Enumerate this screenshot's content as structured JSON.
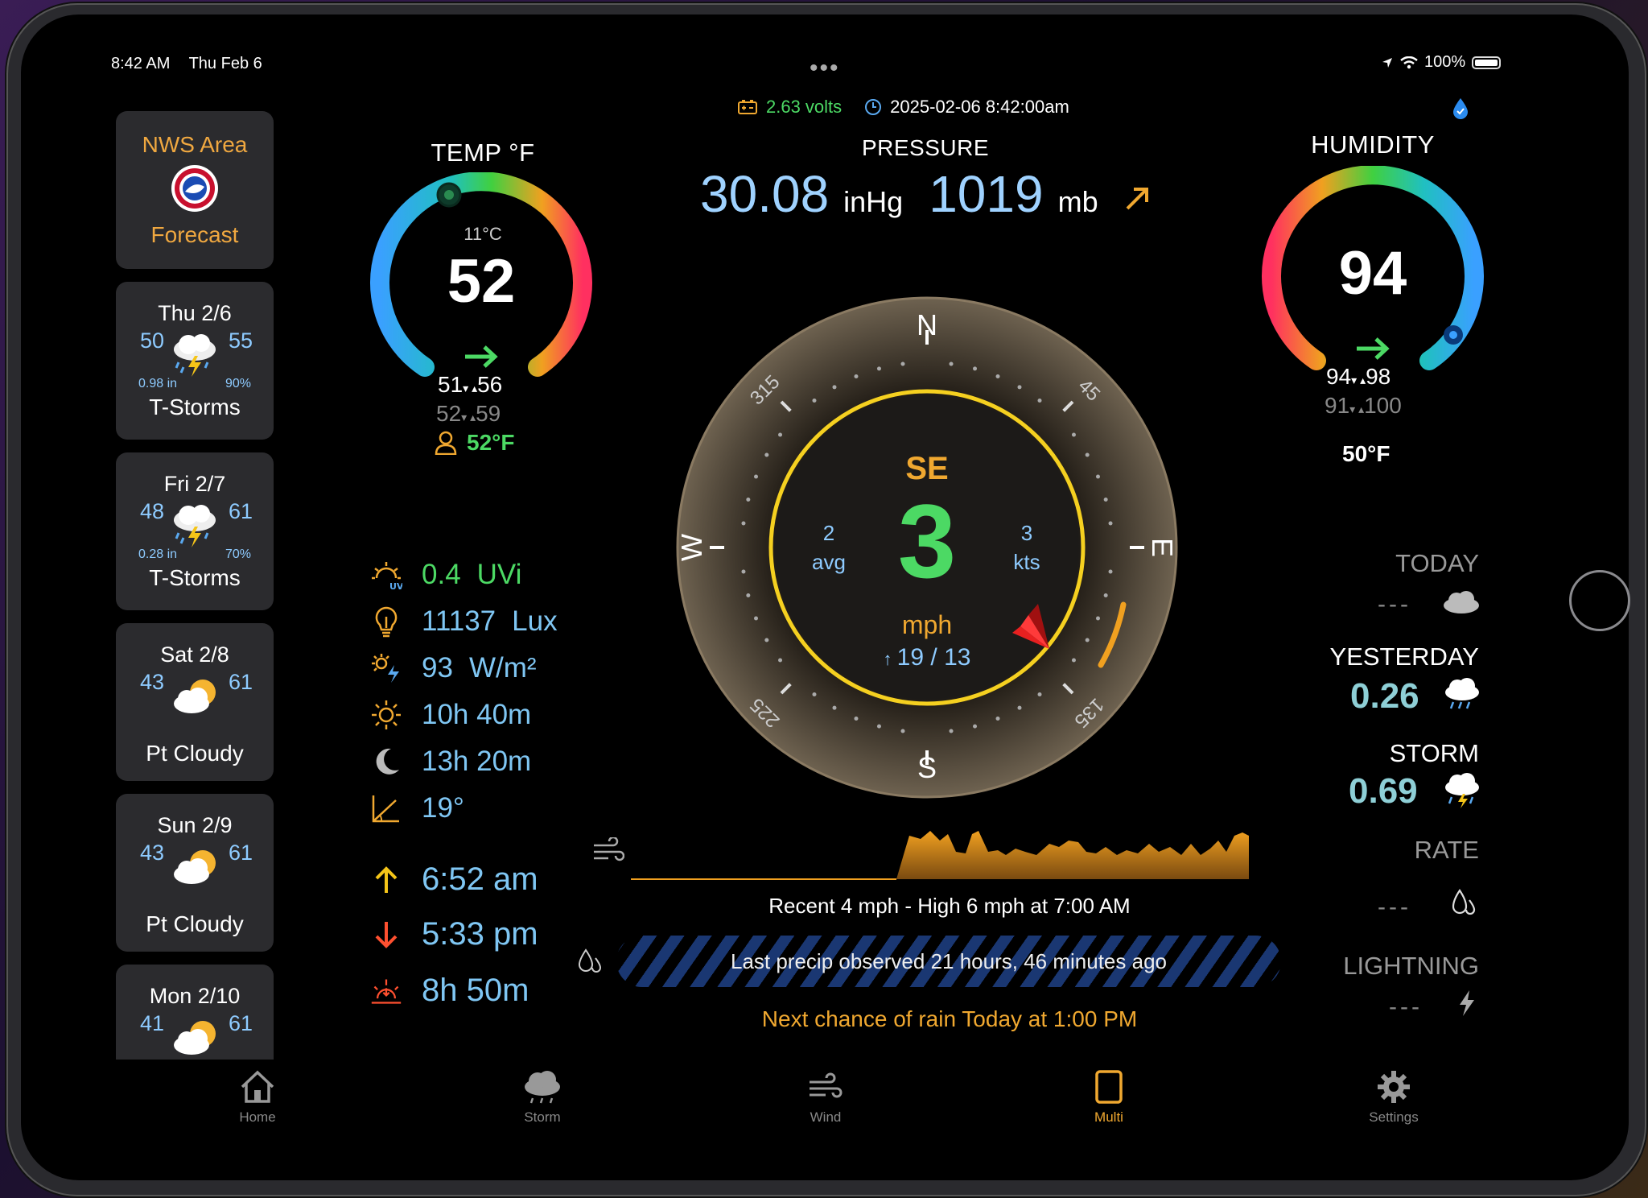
{
  "status": {
    "time": "8:42 AM",
    "date": "Thu Feb 6",
    "battery_pct": "100%",
    "battery_level": 1.0
  },
  "header": {
    "volts": "2.63 volts",
    "timestamp": "2025-02-06 8:42:00am"
  },
  "forecast": {
    "nws_title": "NWS Area",
    "nws_sub": "Forecast",
    "days": [
      {
        "day": "Thu 2/6",
        "lo": "50",
        "hi": "55",
        "rain": "0.98 in",
        "pct": "90%",
        "cond": "T-Storms",
        "icon": "thunderstorm-icon"
      },
      {
        "day": "Fri 2/7",
        "lo": "48",
        "hi": "61",
        "rain": "0.28 in",
        "pct": "70%",
        "cond": "T-Storms",
        "icon": "thunderstorm-icon"
      },
      {
        "day": "Sat 2/8",
        "lo": "43",
        "hi": "61",
        "rain": "",
        "pct": "",
        "cond": "Pt Cloudy",
        "icon": "partly-cloudy-icon"
      },
      {
        "day": "Sun 2/9",
        "lo": "43",
        "hi": "61",
        "rain": "",
        "pct": "",
        "cond": "Pt Cloudy",
        "icon": "partly-cloudy-icon"
      },
      {
        "day": "Mon 2/10",
        "lo": "41",
        "hi": "61",
        "rain": "",
        "pct": "",
        "cond": "",
        "icon": "partly-cloudy-icon"
      }
    ]
  },
  "temp": {
    "label": "TEMP °F",
    "celsius": "11°C",
    "value": "52",
    "low_today": "51",
    "high_today": "56",
    "low_yesterday": "52",
    "high_yesterday": "59",
    "feels_like": "52°F"
  },
  "pressure": {
    "label": "PRESSURE",
    "inhg": "30.08",
    "inhg_unit": "inHg",
    "mb": "1019",
    "mb_unit": "mb"
  },
  "humidity": {
    "label": "HUMIDITY",
    "value": "94",
    "low_today": "94",
    "high_today": "98",
    "low_yesterday": "91",
    "high_yesterday": "100",
    "dew_point": "50°F"
  },
  "sensors": {
    "uv_value": "0.4",
    "uv_unit": "UVi",
    "lux_value": "11137",
    "lux_unit": "Lux",
    "solar_value": "93",
    "solar_unit": "W/m²",
    "daylight": "10h 40m",
    "night": "13h 20m",
    "sun_angle": "19°",
    "sunrise": "6:52 am",
    "sunset": "5:33 pm",
    "golden": "8h 50m"
  },
  "wind": {
    "direction": "SE",
    "speed": "3",
    "unit": "mph",
    "avg": "2",
    "avg_label": "avg",
    "kts": "3",
    "kts_label": "kts",
    "gust_hi": "19",
    "gust_sep": "/",
    "gust_lo": "13",
    "compass": {
      "n": "N",
      "e": "E",
      "s": "S",
      "w": "W",
      "d45": "45",
      "d135": "135",
      "d225": "225",
      "d315": "315"
    },
    "caption": "Recent 4 mph  -  High 6 mph at 7:00 AM"
  },
  "precip": {
    "last_observed": "Last precip observed 21 hours, 46 minutes ago",
    "next_chance": "Next chance of rain Today at 1:00 PM",
    "today_label": "TODAY",
    "today_value": "---",
    "yesterday_label": "YESTERDAY",
    "yesterday_value": "0.26",
    "storm_label": "STORM",
    "storm_value": "0.69",
    "rate_label": "RATE",
    "rate_value": "---",
    "lightning_label": "LIGHTNING",
    "lightning_value": "---"
  },
  "tabs": [
    {
      "label": "Home",
      "icon": "home-icon"
    },
    {
      "label": "Storm",
      "icon": "storm-icon"
    },
    {
      "label": "Wind",
      "icon": "wind-icon"
    },
    {
      "label": "Multi",
      "icon": "multi-icon",
      "active": true
    },
    {
      "label": "Settings",
      "icon": "gear-icon"
    }
  ],
  "colors": {
    "accent": "#f0a830",
    "value_blue": "#8ecbff",
    "green": "#4cd964",
    "compass_ring": "#f5d020",
    "bezel": "#6b5f4d"
  }
}
